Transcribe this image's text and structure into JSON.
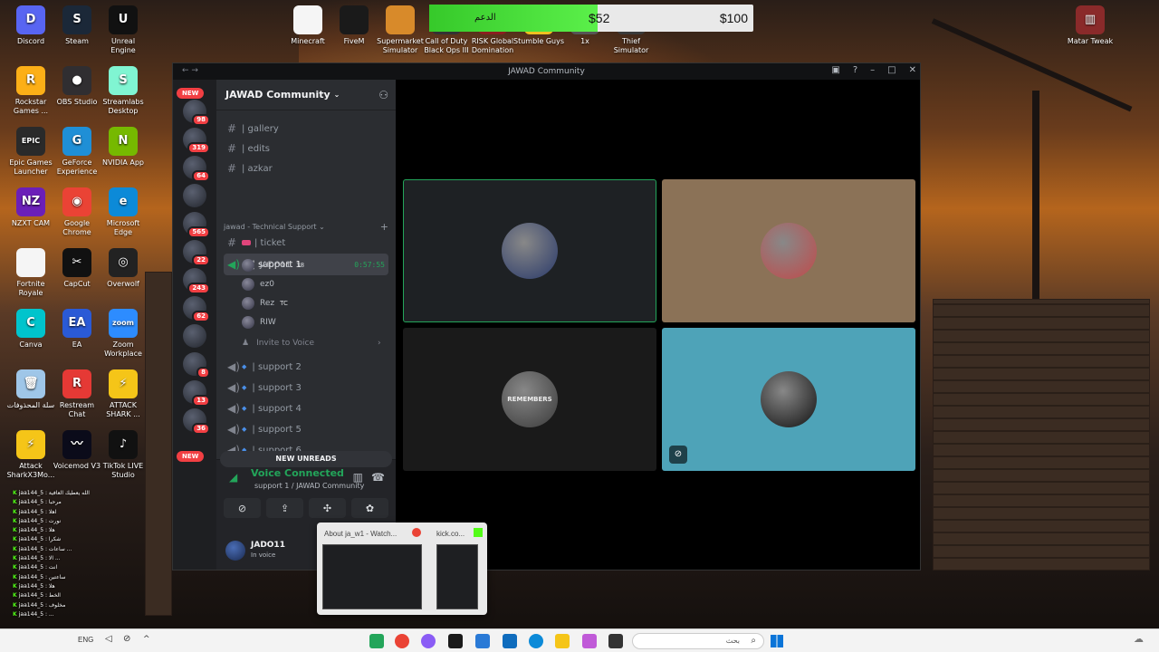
{
  "desktop": {
    "icons": [
      {
        "label": "Discord",
        "color": "#5865f2",
        "glyph": "D"
      },
      {
        "label": "Steam",
        "color": "#1b2838",
        "glyph": "S"
      },
      {
        "label": "Unreal Engine",
        "color": "#111111",
        "glyph": "U"
      },
      {
        "label": "Rockstar Games ...",
        "color": "#fcaf17",
        "glyph": "R"
      },
      {
        "label": "OBS Studio",
        "color": "#302e31",
        "glyph": "●"
      },
      {
        "label": "Streamlabs Desktop",
        "color": "#80f5d2",
        "glyph": "S"
      },
      {
        "label": "Epic Games Launcher",
        "color": "#2a2a2a",
        "glyph": "EPIC"
      },
      {
        "label": "GeForce Experience",
        "color": "#1f8fd6",
        "glyph": "G"
      },
      {
        "label": "NVIDIA App",
        "color": "#76b900",
        "glyph": "N"
      },
      {
        "label": "NZXT CAM",
        "color": "#6b1fb8",
        "glyph": "NZ"
      },
      {
        "label": "Google Chrome",
        "color": "#ea4335",
        "glyph": "◉"
      },
      {
        "label": "Microsoft Edge",
        "color": "#0c8ad8",
        "glyph": "e"
      },
      {
        "label": "Fortnite Royale",
        "color": "#f5f5f5",
        "glyph": ""
      },
      {
        "label": "CapCut",
        "color": "#111111",
        "glyph": "✂"
      },
      {
        "label": "Overwolf",
        "color": "#222222",
        "glyph": "◎"
      },
      {
        "label": "Canva",
        "color": "#00c4cc",
        "glyph": "C"
      },
      {
        "label": "EA",
        "color": "#2a5ad6",
        "glyph": "EA"
      },
      {
        "label": "Zoom Workplace",
        "color": "#2d8cff",
        "glyph": "zoom"
      },
      {
        "label": "سلة المحذوفات",
        "color": "#9fc6e8",
        "glyph": "🗑"
      },
      {
        "label": "Restream Chat",
        "color": "#e53935",
        "glyph": "R"
      },
      {
        "label": "ATTACK SHARK ...",
        "color": "#f5c518",
        "glyph": "⚡"
      },
      {
        "label": "Attack SharkX3Mo...",
        "color": "#f5c518",
        "glyph": "⚡"
      },
      {
        "label": "Voicemod V3",
        "color": "#0b0b1a",
        "glyph": "〰"
      },
      {
        "label": "TikTok LIVE Studio",
        "color": "#111111",
        "glyph": "♪"
      }
    ],
    "top_icons": [
      {
        "label": "Minecraft",
        "color": "#f5f5f5"
      },
      {
        "label": "FiveM",
        "color": "#1a1a1a"
      },
      {
        "label": "Supermarket Simulator",
        "color": "#d88a2a"
      },
      {
        "label": "Call of Duty Black Ops III",
        "color": "#333333"
      },
      {
        "label": "RISK Global Domination",
        "color": "#8a1f1f"
      },
      {
        "label": "Stumble Guys",
        "color": "#f0c020"
      },
      {
        "label": "1x",
        "color": "#555555"
      },
      {
        "label": "Thief Simulator",
        "color": "#3a3a3a"
      }
    ],
    "right_icon": {
      "label": "Matar Tweak",
      "color": "#8a2a2a"
    }
  },
  "donation": {
    "label": "الدعم",
    "current": "$52",
    "goal": "$100",
    "progress": 0.52
  },
  "window": {
    "title": "JAWAD Community",
    "guild_name": "JAWAD Community",
    "servers": [
      {
        "badge": "98"
      },
      {
        "badge": "319"
      },
      {
        "badge": "64"
      },
      {
        "badge": ""
      },
      {
        "badge": "565"
      },
      {
        "badge": "22"
      },
      {
        "badge": "243"
      },
      {
        "badge": "62"
      },
      {
        "badge": ""
      },
      {
        "badge": "8"
      },
      {
        "badge": "13"
      },
      {
        "badge": "36"
      }
    ],
    "new_label": "NEW",
    "channels_top": [
      {
        "name": "| gallery",
        "icon": "#"
      },
      {
        "name": "| edits",
        "icon": "#"
      },
      {
        "name": "| azkar",
        "icon": "#"
      }
    ],
    "category": "jawad - Technical Support",
    "ticket": "| ticket",
    "active_channel": {
      "name": "| support 1",
      "timer": "0:57:55"
    },
    "voice_users": [
      "JADO11",
      "ez0",
      "Rez",
      "RIW"
    ],
    "voice_user_tags": [
      "38",
      "",
      "TC",
      ""
    ],
    "invite": "Invite to Voice",
    "other_channels": [
      "| support 2",
      "| support 3",
      "| support 4",
      "| support 5",
      "| support 6"
    ],
    "new_unreads": "NEW UNREADS",
    "voice_connected": "Voice Connected",
    "voice_status": "support 1 / JAWAD Community",
    "user": {
      "name": "JADO11",
      "status": "In voice"
    }
  },
  "tiles": [
    {
      "name": "tile-1",
      "bg": "#1e2124",
      "border": "#23a55a",
      "avatar": "#2a3a6a"
    },
    {
      "name": "tile-2",
      "bg": "#8b7257",
      "border": "",
      "avatar": "#c04a4a"
    },
    {
      "name": "tile-3",
      "bg": "#1a1a1a",
      "border": "",
      "avatar": "#3a3a3a",
      "caption": "REMEMBERS"
    },
    {
      "name": "tile-4",
      "bg": "#4ea3b8",
      "border": "",
      "avatar": "#111111"
    }
  ],
  "preview": {
    "tab1": "About ja_w1 - Watch...",
    "tab2": "kick.co..."
  },
  "chatlog": [
    "jaa144_5 : الله يعطيك العافية",
    "jaa144_5 : مرحبا",
    "jaa144_5 : اهلا",
    "jaa144_5 : نورت",
    "jaa144_5 : هلا",
    "jaa144_5 : شكرا",
    "jaa144_5 : ساعات ...",
    "jaa144_5 : الا ...",
    "jaa144_5 : انت",
    "jaa144_5 : ساعتين",
    "jaa144_5 : هلا",
    "jaa144_5 : الخط",
    "jaa144_5 : مخلوف",
    "jaa144_5 : ..."
  ],
  "taskbar": {
    "lang": "ENG",
    "search": "بحث"
  }
}
